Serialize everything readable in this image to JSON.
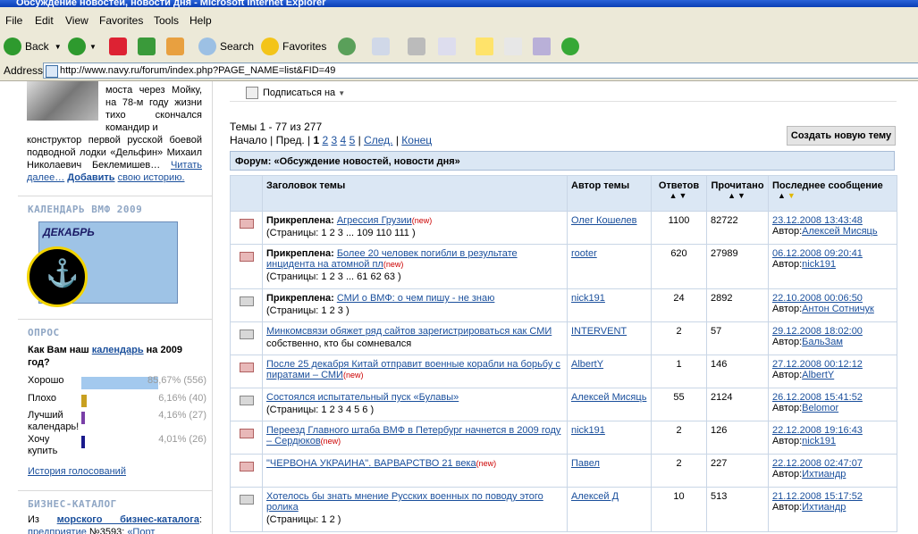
{
  "window": {
    "title": "Обсуждение новостей, новости дня - Microsoft Internet Explorer"
  },
  "menu": [
    "File",
    "Edit",
    "View",
    "Favorites",
    "Tools",
    "Help"
  ],
  "toolbar": {
    "back": "Back",
    "search": "Search",
    "favorites": "Favorites"
  },
  "address": {
    "label": "Address",
    "url": "http://www.navy.ru/forum/index.php?PAGE_NAME=list&FID=49"
  },
  "sidebar": {
    "bio_top1": "моста через Мойку, на 78-м году жизни тихо скончался командир и",
    "bio_rest": "конструктор первой русской боевой подводной лодки «Дельфин» Михаил Николаевич Беклемишев…",
    "bio_more": "Читать далее…",
    "bio_add": "Добавить",
    "bio_add_tail": "свою историю.",
    "calendar_title": "КАЛЕНДАРЬ ВМФ 2009",
    "calendar_month": "ДЕКАБРЬ",
    "poll_title": "ОПРОС",
    "poll_question_a": "Как Вам наш",
    "poll_question_link": "календарь",
    "poll_question_b": "на 2009 год?",
    "poll": [
      {
        "label": "Хорошо",
        "pct": "85,67% (556)",
        "color": "#a3c9ee",
        "share": 0.8567
      },
      {
        "label": "Плохо",
        "pct": "6,16% (40)",
        "color": "#c8a020",
        "share": 0.0616
      },
      {
        "label": "Лучший календарь!",
        "pct": "4,16% (27)",
        "color": "#7a3fa8",
        "share": 0.0416
      },
      {
        "label": "Хочу купить",
        "pct": "4,01% (26)",
        "color": "#1a1a8c",
        "share": 0.0401
      }
    ],
    "poll_history": "История голосований",
    "biz_title": "БИЗНЕС-КАТАЛОГ",
    "biz_a": "Из",
    "biz_link": "морского бизнес-каталога",
    "biz_b": ":",
    "biz_c": "предприятие",
    "biz_d": "№3593:",
    "biz_e": "«Порт"
  },
  "main": {
    "subscribe": "Подписаться на",
    "count": "Темы 1 - 77 из 277",
    "pager_start": "Начало",
    "pager_prev": "Пред.",
    "pager_current": "1",
    "pager_pages": [
      "2",
      "3",
      "4",
      "5"
    ],
    "pager_next": "След.",
    "pager_end": "Конец",
    "new_topic": "Создать новую тему",
    "forum_header": "Форум: «Обсуждение новостей, новости дня»",
    "columns": {
      "title": "Заголовок темы",
      "author": "Автор темы",
      "replies": "Ответов",
      "views": "Прочитано",
      "last": "Последнее сообщение"
    },
    "topics": [
      {
        "pinned": "Прикреплена:",
        "title": "Агрессия Грузии",
        "new": "(new)",
        "pages": "(Страницы: 1 2 3 ... 109 110 111 )",
        "author": "Олег Кошелев",
        "replies": "1100",
        "views": "82722",
        "date": "23.12.2008 13:43:48",
        "last_author": "Алексей Мисяць",
        "red": true
      },
      {
        "pinned": "Прикреплена:",
        "title": "Более 20 человек погибли в результате инцидента на атомной пл",
        "new": "(new)",
        "pages": "(Страницы: 1 2 3 ... 61 62 63 )",
        "author": "rooter",
        "replies": "620",
        "views": "27989",
        "date": "06.12.2008 09:20:41",
        "last_author": "nick191",
        "red": true
      },
      {
        "pinned": "Прикреплена:",
        "title": "СМИ о ВМФ: о чем пишу - не знаю",
        "new": "",
        "pages": "(Страницы: 1 2 3 )",
        "author": "nick191",
        "replies": "24",
        "views": "2892",
        "date": "22.10.2008 00:06:50",
        "last_author": "Антон Сотничук",
        "red": false
      },
      {
        "pinned": "",
        "title": "Минкомсвязи обяжет ряд сайтов зарегистрироваться как СМИ",
        "tail": "собственно, кто бы сомневался",
        "new": "",
        "pages": "",
        "author": "INTERVENT",
        "replies": "2",
        "views": "57",
        "date": "29.12.2008 18:02:00",
        "last_author": "БальЗам",
        "red": false
      },
      {
        "pinned": "",
        "title": "После 25 декабря Китай отправит военные корабли на борьбу с пиратами – СМИ",
        "new": "(new)",
        "pages": "",
        "author": "AlbertY",
        "replies": "1",
        "views": "146",
        "date": "27.12.2008 00:12:12",
        "last_author": "AlbertY",
        "red": true
      },
      {
        "pinned": "",
        "title": "Состоялся испытательный пуск «Булавы»",
        "new": "",
        "pages": "(Страницы: 1 2 3 4 5 6 )",
        "author": "Алексей Мисяць",
        "replies": "55",
        "views": "2124",
        "date": "26.12.2008 15:41:52",
        "last_author": "Belomor",
        "red": false
      },
      {
        "pinned": "",
        "title": "Переезд Главного штаба ВМФ в Петербург начнется в 2009 году – Сердюков",
        "new": "(new)",
        "pages": "",
        "author": "nick191",
        "replies": "2",
        "views": "126",
        "date": "22.12.2008 19:16:43",
        "last_author": "nick191",
        "red": true
      },
      {
        "pinned": "",
        "title": "\"ЧЕРВОНА УКРАИНА\". ВАРВАРСТВО 21 века",
        "new": "(new)",
        "pages": "",
        "author": "Павел",
        "replies": "2",
        "views": "227",
        "date": "22.12.2008 02:47:07",
        "last_author": "Ихтиандр",
        "red": true
      },
      {
        "pinned": "",
        "title": "Хотелось бы знать мнение Русских военных по поводу этого ролика",
        "new": "",
        "pages": "(Страницы: 1 2 )",
        "author": "Алексей Д",
        "replies": "10",
        "views": "513",
        "date": "21.12.2008 15:17:52",
        "last_author": "Ихтиандр",
        "red": false
      }
    ],
    "author_prefix": "Автор:"
  }
}
